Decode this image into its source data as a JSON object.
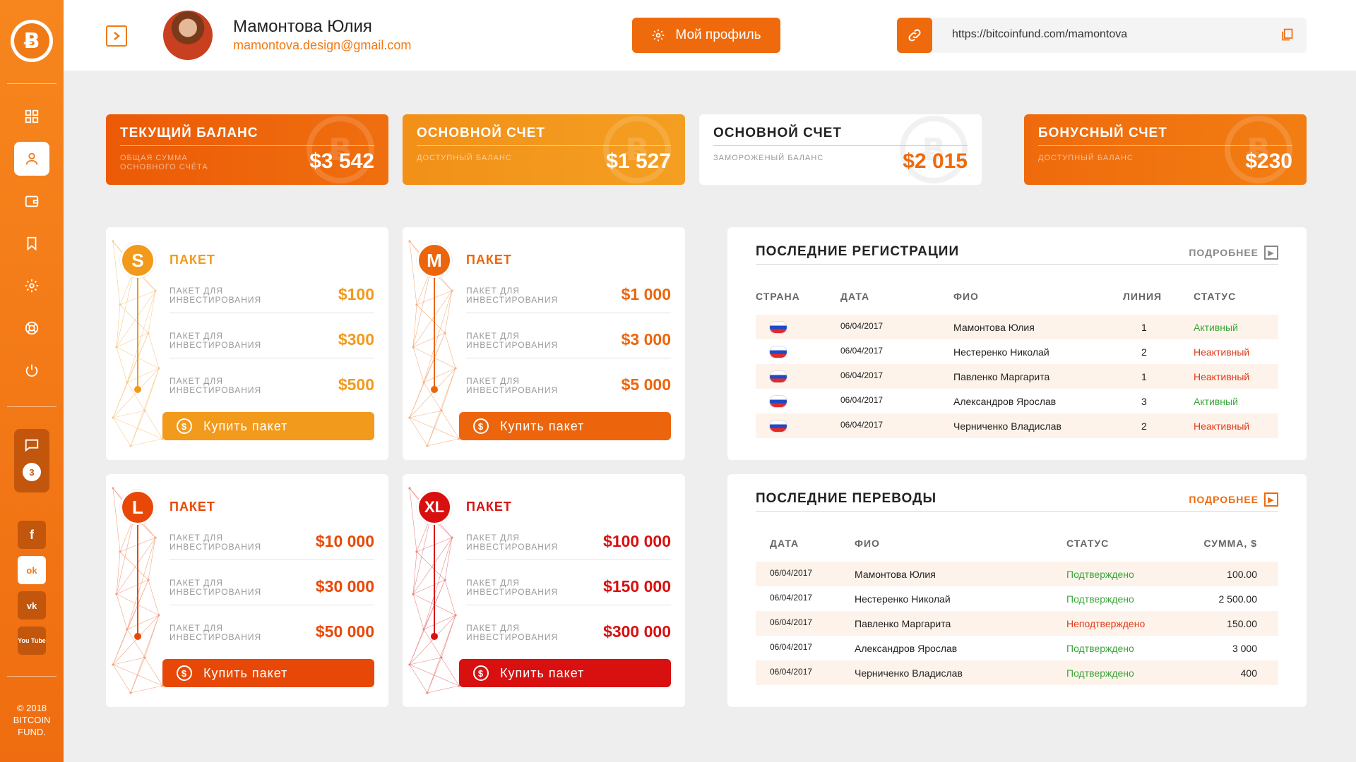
{
  "sidebar": {
    "logo_glyph": "Ƀ",
    "chat_count": "3",
    "social": [
      "f",
      "ok",
      "vk",
      "You Tube"
    ],
    "copyright": [
      "© 2018",
      "BITCOIN",
      "FUND."
    ]
  },
  "header": {
    "name": "Мамонтова Юлия",
    "email": "mamontova.design@gmail.com",
    "profile_button": "Мой профиль",
    "ref_url": "https://bitcoinfund.com/mamontova"
  },
  "balances": [
    {
      "title": "ТЕКУЩИЙ БАЛАНС",
      "sub": "ОБЩАЯ СУММА ОСНОВНОГО СЧЁТА",
      "value": "$3 542"
    },
    {
      "title": "ОСНОВНОЙ СЧЕТ",
      "sub": "ДОСТУПНЫЙ БАЛАНС",
      "value": "$1 527"
    },
    {
      "title": "ОСНОВНОЙ СЧЕТ",
      "sub": "ЗАМОРОЖЕНЫЙ БАЛАНС",
      "value": "$2 015"
    },
    {
      "title": "БОНУСНЫЙ СЧЕТ",
      "sub": "ДОСТУПНЫЙ БАЛАНС",
      "value": "$230"
    }
  ],
  "packages": [
    {
      "badge": "S",
      "title": "ПАКЕТ",
      "color": "#f29a1c",
      "rows": [
        {
          "label": "ПАКЕТ ДЛЯ ИНВЕСТИРОВАНИЯ",
          "value": "$100"
        },
        {
          "label": "ПАКЕТ ДЛЯ ИНВЕСТИРОВАНИЯ",
          "value": "$300"
        },
        {
          "label": "ПАКЕТ ДЛЯ ИНВЕСТИРОВАНИЯ",
          "value": "$500"
        }
      ],
      "button": "Купить пакет"
    },
    {
      "badge": "M",
      "title": "ПАКЕТ",
      "color": "#ec650c",
      "rows": [
        {
          "label": "ПАКЕТ ДЛЯ ИНВЕСТИРОВАНИЯ",
          "value": "$1 000"
        },
        {
          "label": "ПАКЕТ ДЛЯ ИНВЕСТИРОВАНИЯ",
          "value": "$3 000"
        },
        {
          "label": "ПАКЕТ ДЛЯ ИНВЕСТИРОВАНИЯ",
          "value": "$5 000"
        }
      ],
      "button": "Купить пакет"
    },
    {
      "badge": "L",
      "title": "ПАКЕТ",
      "color": "#e84807",
      "rows": [
        {
          "label": "ПАКЕТ ДЛЯ ИНВЕСТИРОВАНИЯ",
          "value": "$10 000"
        },
        {
          "label": "ПАКЕТ ДЛЯ ИНВЕСТИРОВАНИЯ",
          "value": "$30 000"
        },
        {
          "label": "ПАКЕТ ДЛЯ ИНВЕСТИРОВАНИЯ",
          "value": "$50 000"
        }
      ],
      "button": "Купить пакет"
    },
    {
      "badge": "XL",
      "title": "ПАКЕТ",
      "color": "#d81010",
      "rows": [
        {
          "label": "ПАКЕТ ДЛЯ ИНВЕСТИРОВАНИЯ",
          "value": "$100 000"
        },
        {
          "label": "ПАКЕТ ДЛЯ ИНВЕСТИРОВАНИЯ",
          "value": "$150 000"
        },
        {
          "label": "ПАКЕТ ДЛЯ ИНВЕСТИРОВАНИЯ",
          "value": "$300 000"
        }
      ],
      "button": "Купить пакет"
    }
  ],
  "registrations": {
    "title": "ПОСЛЕДНИЕ РЕГИСТРАЦИИ",
    "more": "ПОДРОБНЕЕ",
    "headers": [
      "СТРАНА",
      "ДАТА",
      "ФИО",
      "ЛИНИЯ",
      "СТАТУС"
    ],
    "rows": [
      {
        "date": "06/04/2017",
        "name": "Мамонтова Юлия",
        "line": "1",
        "status": "Активный",
        "ok": true
      },
      {
        "date": "06/04/2017",
        "name": "Нестеренко Николай",
        "line": "2",
        "status": "Неактивный",
        "ok": false
      },
      {
        "date": "06/04/2017",
        "name": "Павленко Маргарита",
        "line": "1",
        "status": "Неактивный",
        "ok": false
      },
      {
        "date": "06/04/2017",
        "name": "Александров Ярослав",
        "line": "3",
        "status": "Активный",
        "ok": true
      },
      {
        "date": "06/04/2017",
        "name": "Черниченко Владислав",
        "line": "2",
        "status": "Неактивный",
        "ok": false
      }
    ]
  },
  "transfers": {
    "title": "ПОСЛЕДНИЕ ПЕРЕВОДЫ",
    "more": "ПОДРОБНЕЕ",
    "headers": [
      "ДАТА",
      "ФИО",
      "СТАТУС",
      "СУММА, $"
    ],
    "rows": [
      {
        "date": "06/04/2017",
        "name": "Мамонтова Юлия",
        "status": "Подтверждено",
        "ok": true,
        "amount": "100.00"
      },
      {
        "date": "06/04/2017",
        "name": "Нестеренко Николай",
        "status": "Подтверждено",
        "ok": true,
        "amount": "2 500.00"
      },
      {
        "date": "06/04/2017",
        "name": "Павленко Маргарита",
        "status": "Неподтверждено",
        "ok": false,
        "amount": "150.00"
      },
      {
        "date": "06/04/2017",
        "name": "Александров Ярослав",
        "status": "Подтверждено",
        "ok": true,
        "amount": "3 000"
      },
      {
        "date": "06/04/2017",
        "name": "Черниченко Владислав",
        "status": "Подтверждено",
        "ok": true,
        "amount": "400"
      }
    ]
  }
}
